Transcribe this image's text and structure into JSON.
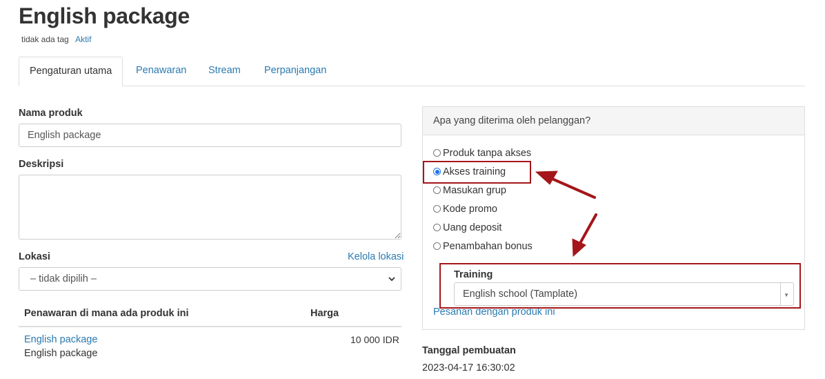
{
  "page": {
    "title": "English package",
    "tag_text": "tidak ada tag",
    "status": "Aktif"
  },
  "tabs": [
    {
      "label": "Pengaturan utama",
      "active": true
    },
    {
      "label": "Penawaran"
    },
    {
      "label": "Stream"
    },
    {
      "label": "Perpanjangan"
    }
  ],
  "form": {
    "name_label": "Nama produk",
    "name_value": "English package",
    "description_label": "Deskripsi",
    "description_value": "",
    "location_label": "Lokasi",
    "location_manage_link": "Kelola lokasi",
    "location_selected": "– tidak dipilih –"
  },
  "offers_table": {
    "headers": [
      "Penawaran di mana ada produk ini",
      "Harga"
    ],
    "rows": [
      {
        "offer_link": "English package",
        "offer_subtitle": "English package",
        "price": "10 000 IDR"
      }
    ]
  },
  "access_panel": {
    "title": "Apa yang diterima oleh pelanggan?",
    "options": [
      {
        "label": "Produk tanpa akses",
        "checked": false
      },
      {
        "label": "Akses training",
        "checked": true
      },
      {
        "label": "Masukan grup",
        "checked": false
      },
      {
        "label": "Kode promo",
        "checked": false
      },
      {
        "label": "Uang deposit",
        "checked": false
      },
      {
        "label": "Penambahan bonus",
        "checked": false
      }
    ],
    "training_label": "Training",
    "training_selected": "English school (Tamplate)",
    "orders_link": "Pesanan dengan produk ini"
  },
  "created": {
    "label": "Tanggal pembuatan",
    "value": "2023-04-17 16:30:02"
  },
  "colors": {
    "link": "#2a7ab0",
    "annotation": "#a4161a",
    "radio_checked": "#1a73e8"
  }
}
